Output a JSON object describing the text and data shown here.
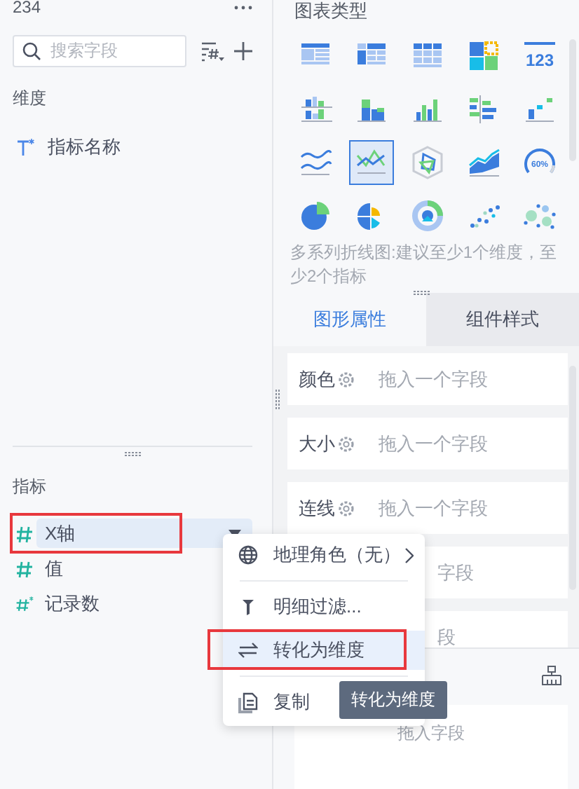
{
  "left_panel": {
    "header": "234",
    "search": {
      "placeholder": "搜索字段"
    },
    "dimensions": {
      "title": "维度",
      "items": [
        {
          "name": "指标名称",
          "kind": "text"
        }
      ]
    },
    "measures": {
      "title": "指标",
      "items": [
        {
          "name": "X轴",
          "kind": "number",
          "selected": true,
          "boxed": true
        },
        {
          "name": "值",
          "kind": "number",
          "selected": false,
          "boxed": false
        },
        {
          "name": "记录数",
          "kind": "number-calc",
          "selected": false,
          "boxed": false
        }
      ]
    }
  },
  "chart_panel": {
    "title": "图表类型",
    "chart_types": [
      {
        "kind": "table",
        "selected": false
      },
      {
        "kind": "pivot-table",
        "selected": false
      },
      {
        "kind": "grid-table",
        "selected": false
      },
      {
        "kind": "tiles",
        "selected": false
      },
      {
        "kind": "number",
        "text": "123",
        "selected": false
      },
      {
        "kind": "grouped-bar",
        "selected": false
      },
      {
        "kind": "stacked-bar",
        "selected": false
      },
      {
        "kind": "bar-chart",
        "selected": false
      },
      {
        "kind": "horizontal-bar",
        "selected": false
      },
      {
        "kind": "step-bar",
        "selected": false
      },
      {
        "kind": "wave-lines",
        "selected": false
      },
      {
        "kind": "line-chart",
        "selected": true
      },
      {
        "kind": "radar-chart",
        "selected": false
      },
      {
        "kind": "area-chart",
        "selected": false
      },
      {
        "kind": "gauge",
        "text": "60%",
        "selected": false
      },
      {
        "kind": "pie-chart",
        "selected": false
      },
      {
        "kind": "rose-chart",
        "selected": false
      },
      {
        "kind": "donut-chart",
        "selected": false
      },
      {
        "kind": "scatter-chart",
        "selected": false
      },
      {
        "kind": "bubble-chart",
        "selected": false
      }
    ],
    "hint": "多系列折线图:建议至少1个维度，至少2个指标"
  },
  "tabs": [
    {
      "label": "图形属性",
      "selected": true
    },
    {
      "label": "组件样式",
      "selected": false
    }
  ],
  "fields": [
    {
      "kind": "labeled",
      "label": "颜色",
      "placeholder": "拖入一个字段"
    },
    {
      "kind": "labeled",
      "label": "大小",
      "placeholder": "拖入一个字段"
    },
    {
      "kind": "labeled",
      "label": "连线",
      "placeholder": "拖入一个字段"
    },
    {
      "kind": "partial",
      "placeholder": "字段"
    },
    {
      "kind": "partial",
      "placeholder": "段"
    }
  ],
  "drop_zone": {
    "placeholder": "拖入字段"
  },
  "context_menu": {
    "items": [
      {
        "kind": "globe",
        "label": "地理角色（无）",
        "submenu": true,
        "selected": false,
        "boxed": false,
        "divider_after": true
      },
      {
        "kind": "filter",
        "label": "明细过滤...",
        "submenu": false,
        "selected": false,
        "boxed": false,
        "divider_after": false
      },
      {
        "kind": "convert",
        "label": "转化为维度",
        "submenu": false,
        "selected": true,
        "boxed": true,
        "divider_after": true
      },
      {
        "kind": "copy",
        "label": "复制",
        "submenu": false,
        "selected": false,
        "boxed": false,
        "divider_after": false
      }
    ]
  },
  "tooltip": "转化为维度"
}
